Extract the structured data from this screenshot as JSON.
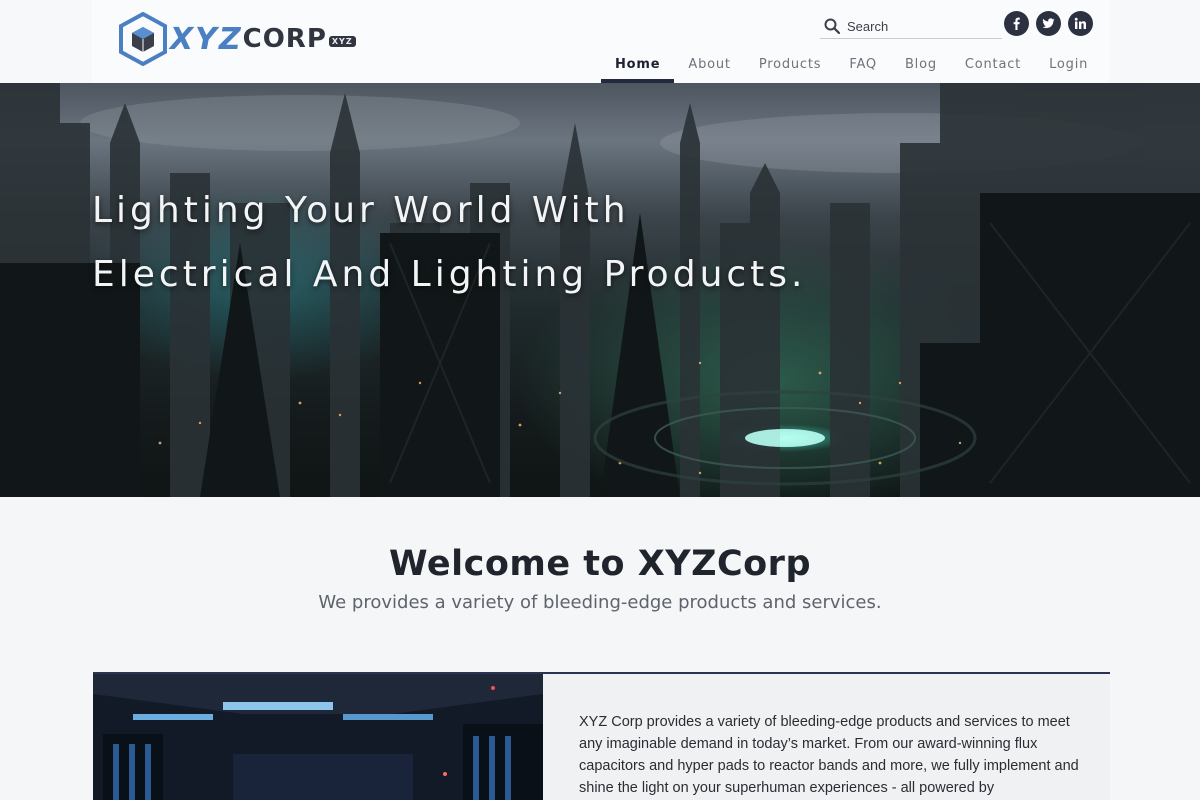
{
  "brand": {
    "logo_xyz": "XYZ",
    "logo_corp": "CORP",
    "logo_badge": "XYZ"
  },
  "search": {
    "placeholder": "Search"
  },
  "social": [
    {
      "name": "facebook-icon",
      "glyph": "f"
    },
    {
      "name": "twitter-icon",
      "glyph": "t"
    },
    {
      "name": "linkedin-icon",
      "glyph": "in"
    }
  ],
  "nav": {
    "items": [
      {
        "label": "Home",
        "active": true
      },
      {
        "label": "About",
        "active": false
      },
      {
        "label": "Products",
        "active": false
      },
      {
        "label": "FAQ",
        "active": false
      },
      {
        "label": "Blog",
        "active": false
      },
      {
        "label": "Contact",
        "active": false
      },
      {
        "label": "Login",
        "active": false
      }
    ]
  },
  "hero": {
    "line1": "Lighting Your World With",
    "line2": "Electrical And Lighting Products."
  },
  "welcome": {
    "title": "Welcome to XYZCorp",
    "subtitle": "We provides a variety of bleeding-edge products and services."
  },
  "feature": {
    "text": "XYZ Corp provides a variety of bleeding-edge products and services to meet any imaginable demand in today’s market. From our award-winning flux capacitors and hyper pads to reactor bands and more, we fully implement and shine the light on your superhuman experiences - all powered by"
  },
  "colors": {
    "nav_active": "#232a3f",
    "social_bg": "#2b3140",
    "accent_blue": "#4a7fc1"
  }
}
